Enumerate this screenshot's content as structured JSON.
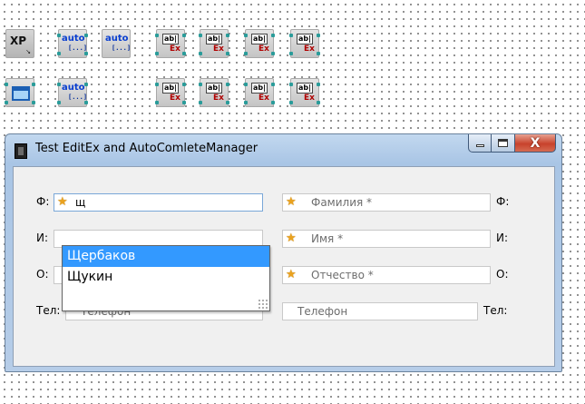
{
  "designer": {
    "components": [
      {
        "name": "xp-manifest-component",
        "kind": "xp",
        "text": "XP"
      },
      {
        "name": "autocomplete-manager-1",
        "kind": "auto",
        "text": "auto",
        "sub": "[...]"
      },
      {
        "name": "autocomplete-manager-2",
        "kind": "auto",
        "text": "auto",
        "sub": "[...]"
      },
      {
        "name": "editex-component-1",
        "kind": "editex",
        "text": "ab|",
        "sub": "Ex"
      },
      {
        "name": "editex-component-2",
        "kind": "editex",
        "text": "ab|",
        "sub": "Ex"
      },
      {
        "name": "editex-component-3",
        "kind": "editex",
        "text": "ab|",
        "sub": "Ex"
      },
      {
        "name": "editex-component-4",
        "kind": "editex",
        "text": "ab|",
        "sub": "Ex"
      },
      {
        "name": "form-component",
        "kind": "window",
        "text": ""
      },
      {
        "name": "autocomplete-manager-3",
        "kind": "auto",
        "text": "auto",
        "sub": "[...]"
      },
      {
        "name": "editex-component-5",
        "kind": "editex",
        "text": "ab|",
        "sub": "Ex"
      },
      {
        "name": "editex-component-6",
        "kind": "editex",
        "text": "ab|",
        "sub": "Ex"
      },
      {
        "name": "editex-component-7",
        "kind": "editex",
        "text": "ab|",
        "sub": "Ex"
      },
      {
        "name": "editex-component-8",
        "kind": "editex",
        "text": "ab|",
        "sub": "Ex"
      }
    ]
  },
  "window": {
    "title": "Test EditEx and AutoComleteManager",
    "close_glyph": "X"
  },
  "form": {
    "left": {
      "surname_label": "Ф:",
      "surname_value": "щ",
      "name_label": "И:",
      "patronymic_label": "О:",
      "phone_label": "Тел:",
      "phone_placeholder": "Телефон"
    },
    "right": {
      "surname_label": "Ф:",
      "surname_placeholder": "Фамилия *",
      "name_label": "И:",
      "name_placeholder": "Имя *",
      "patronymic_label": "О:",
      "patronymic_placeholder": "Отчество *",
      "phone_label": "Тел:",
      "phone_placeholder": "Телефон"
    },
    "star_icon": "★"
  },
  "autocomplete": {
    "items": [
      "Щербаков",
      "Щукин"
    ],
    "selected_index": 0
  }
}
